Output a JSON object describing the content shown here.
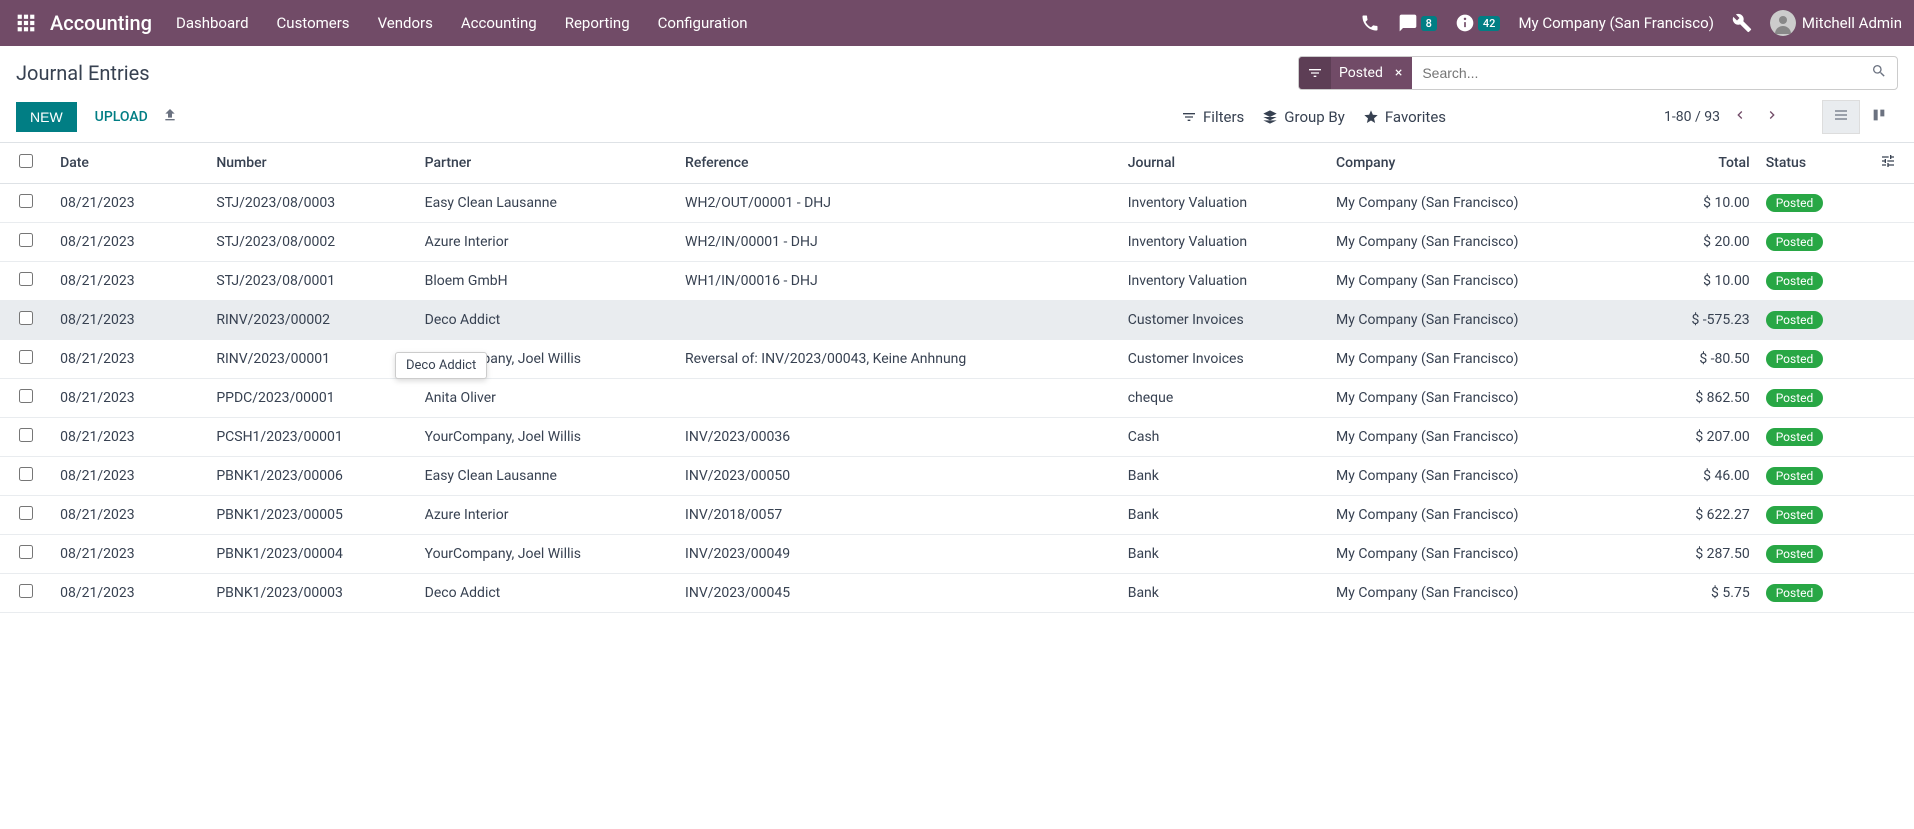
{
  "navbar": {
    "brand": "Accounting",
    "menu": [
      "Dashboard",
      "Customers",
      "Vendors",
      "Accounting",
      "Reporting",
      "Configuration"
    ],
    "discuss_badge": "8",
    "activity_badge": "42",
    "company": "My Company (San Francisco)",
    "user": "Mitchell Admin"
  },
  "breadcrumb": "Journal Entries",
  "search": {
    "facet_label": "Posted",
    "placeholder": "Search..."
  },
  "buttons": {
    "new": "NEW",
    "upload": "UPLOAD"
  },
  "search_options": {
    "filters": "Filters",
    "groupby": "Group By",
    "favorites": "Favorites"
  },
  "pager": {
    "range": "1-80",
    "sep": "/",
    "total": "93"
  },
  "columns": {
    "date": "Date",
    "number": "Number",
    "partner": "Partner",
    "reference": "Reference",
    "journal": "Journal",
    "company": "Company",
    "total": "Total",
    "status": "Status"
  },
  "tooltip": "Deco Addict",
  "rows": [
    {
      "date": "08/21/2023",
      "number": "STJ/2023/08/0003",
      "partner": "Easy Clean Lausanne",
      "reference": "WH2/OUT/00001 - DHJ",
      "journal": "Inventory Valuation",
      "company": "My Company (San Francisco)",
      "total": "$ 10.00",
      "status": "Posted",
      "hl": false
    },
    {
      "date": "08/21/2023",
      "number": "STJ/2023/08/0002",
      "partner": "Azure Interior",
      "reference": "WH2/IN/00001 - DHJ",
      "journal": "Inventory Valuation",
      "company": "My Company (San Francisco)",
      "total": "$ 20.00",
      "status": "Posted",
      "hl": false
    },
    {
      "date": "08/21/2023",
      "number": "STJ/2023/08/0001",
      "partner": "Bloem GmbH",
      "reference": "WH1/IN/00016 - DHJ",
      "journal": "Inventory Valuation",
      "company": "My Company (San Francisco)",
      "total": "$ 10.00",
      "status": "Posted",
      "hl": false
    },
    {
      "date": "08/21/2023",
      "number": "RINV/2023/00002",
      "partner": "Deco Addict",
      "reference": "",
      "journal": "Customer Invoices",
      "company": "My Company (San Francisco)",
      "total": "$ -575.23",
      "status": "Posted",
      "hl": true
    },
    {
      "date": "08/21/2023",
      "number": "RINV/2023/00001",
      "partner": "YourCompany, Joel Willis",
      "reference": "Reversal of: INV/2023/00043, Keine Anhnung",
      "journal": "Customer Invoices",
      "company": "My Company (San Francisco)",
      "total": "$ -80.50",
      "status": "Posted",
      "hl": false
    },
    {
      "date": "08/21/2023",
      "number": "PPDC/2023/00001",
      "partner": "Anita Oliver",
      "reference": "",
      "journal": "cheque",
      "company": "My Company (San Francisco)",
      "total": "$ 862.50",
      "status": "Posted",
      "hl": false
    },
    {
      "date": "08/21/2023",
      "number": "PCSH1/2023/00001",
      "partner": "YourCompany, Joel Willis",
      "reference": "INV/2023/00036",
      "journal": "Cash",
      "company": "My Company (San Francisco)",
      "total": "$ 207.00",
      "status": "Posted",
      "hl": false
    },
    {
      "date": "08/21/2023",
      "number": "PBNK1/2023/00006",
      "partner": "Easy Clean Lausanne",
      "reference": "INV/2023/00050",
      "journal": "Bank",
      "company": "My Company (San Francisco)",
      "total": "$ 46.00",
      "status": "Posted",
      "hl": false
    },
    {
      "date": "08/21/2023",
      "number": "PBNK1/2023/00005",
      "partner": "Azure Interior",
      "reference": "INV/2018/0057",
      "journal": "Bank",
      "company": "My Company (San Francisco)",
      "total": "$ 622.27",
      "status": "Posted",
      "hl": false
    },
    {
      "date": "08/21/2023",
      "number": "PBNK1/2023/00004",
      "partner": "YourCompany, Joel Willis",
      "reference": "INV/2023/00049",
      "journal": "Bank",
      "company": "My Company (San Francisco)",
      "total": "$ 287.50",
      "status": "Posted",
      "hl": false
    },
    {
      "date": "08/21/2023",
      "number": "PBNK1/2023/00003",
      "partner": "Deco Addict",
      "reference": "INV/2023/00045",
      "journal": "Bank",
      "company": "My Company (San Francisco)",
      "total": "$ 5.75",
      "status": "Posted",
      "hl": false
    }
  ]
}
